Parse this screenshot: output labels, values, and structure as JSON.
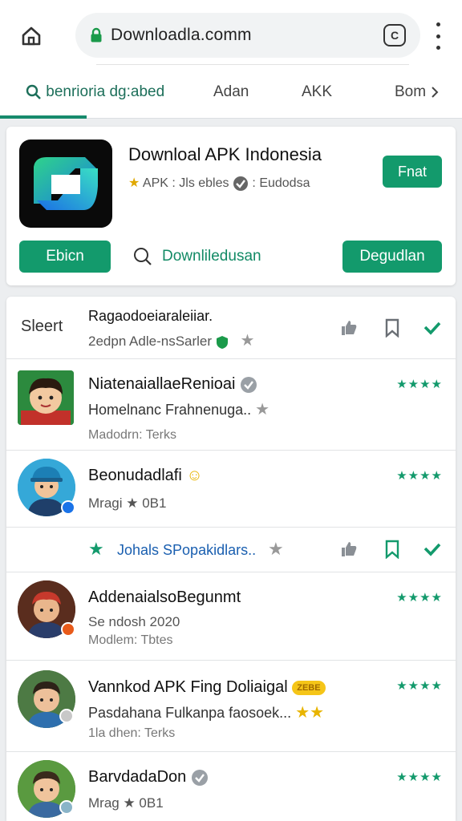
{
  "browser": {
    "url": "Downloadla.comm",
    "tab_switch_label": "C"
  },
  "tabs": [
    {
      "label": "benrioria dg:abed"
    },
    {
      "label": "Adan"
    },
    {
      "label": "AKK"
    },
    {
      "label": "Bom"
    }
  ],
  "app": {
    "title": "Downloal APK Indonesia",
    "subtitle_part1": "APK : Jls ebles",
    "subtitle_part2": ": Eudodsa",
    "top_button": "Fnat",
    "left_button": "Ebicn",
    "download_link": "Downliledusan",
    "right_button": "Degudlan"
  },
  "list": {
    "header_label": "Sleert",
    "rows": [
      {
        "title": "Ragaodoeiaraleiiar.",
        "line1": "2edpn Adle-nsSarler"
      },
      {
        "title": "NiatenaiallaeRenioai",
        "line1": "Homelnanc Frahnenuga..",
        "meta": "Madodrn: Terks",
        "stars": "★★★★"
      },
      {
        "title": "Beonudadlafi",
        "line1": "Mragi ★ 0B1",
        "stars": "★★★★"
      },
      {
        "link": "Johals SPopakidlars.."
      },
      {
        "title": "AddenaialsoBegunmt",
        "line1": "Se ndosh 2020",
        "meta": "Modlem: Tbtes",
        "stars": "★★★★"
      },
      {
        "title": "Vannkod APK Fing Doliaigal",
        "tag": "ZEBE",
        "line1": "Pasdahana Fulkanpa faosoek...",
        "meta": "1la dhen: Terks",
        "stars": "★★★★"
      },
      {
        "title": "BarvdadaDon",
        "line1": "Mrag ★ 0B1",
        "stars": "★★★★"
      }
    ]
  }
}
